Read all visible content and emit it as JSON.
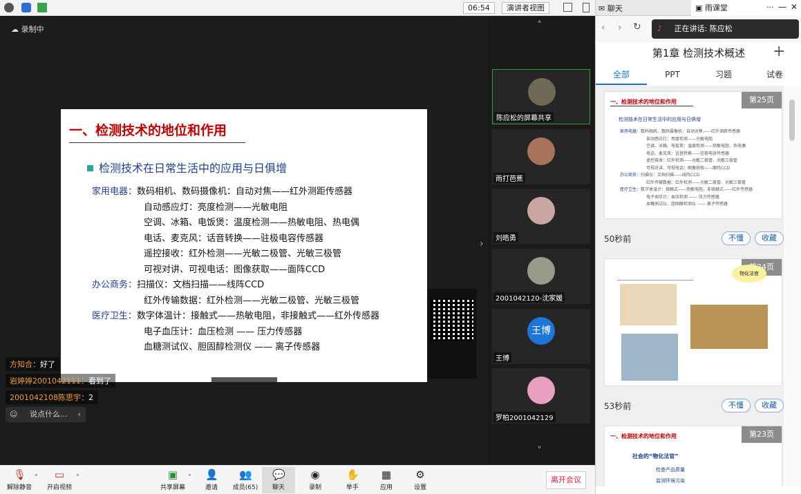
{
  "top": {
    "time": "06:54",
    "view_label": "演讲者视图"
  },
  "recording": "录制中",
  "slide": {
    "title": "一、检测技术的地位和作用",
    "subtitle": "检测技术在日常生活中的应用与日俱增",
    "lines": [
      {
        "cat": "家用电器：",
        "text": "数码相机、数码摄像机：自动对焦——红外测距传感器"
      },
      {
        "cat": "",
        "text": "自动感应灯：亮度检测——光敏电阻"
      },
      {
        "cat": "",
        "text": "空调、冰箱、电饭煲：温度检测——热敏电阻、热电偶"
      },
      {
        "cat": "",
        "text": "电话、麦克风：话音转换——驻极电容传感器"
      },
      {
        "cat": "",
        "text": "遥控接收：红外检测——光敏二极管、光敏三极管"
      },
      {
        "cat": "",
        "text": "可视对讲、可视电话：图像获取——面阵CCD"
      },
      {
        "cat": "办公商务：",
        "text": "扫描仪：文档扫描——线阵CCD"
      },
      {
        "cat": "",
        "text": "红外传输数据：红外检测——光敏二极管、光敏三极管"
      },
      {
        "cat": "医疗卫生：",
        "text": "数字体温计：接触式——热敏电阻，非接触式——红外传感器"
      },
      {
        "cat": "",
        "text": "电子血压计：血压检测 —— 压力传感器"
      },
      {
        "cat": "",
        "text": "血糖测试仪、胆固醇检测仪 —— 离子传感器"
      }
    ]
  },
  "chat": [
    {
      "name": "方知合：",
      "text": "好了"
    },
    {
      "name": "岩婷婷2001042111：",
      "text": "看到了"
    },
    {
      "name": "2001042108陈思宇：",
      "text": "2"
    }
  ],
  "say_placeholder": "说点什么...",
  "participants": [
    {
      "label": "陈应松的屏幕共享"
    },
    {
      "label": "雨打芭蕉"
    },
    {
      "label": "刘皓勇"
    },
    {
      "label": "2001042120-沈家媛"
    },
    {
      "label": "王博",
      "initials": "王博"
    },
    {
      "label": "罗柏2001042129"
    }
  ],
  "right": {
    "tab_chat": "聊天",
    "tab_rain": "雨课堂",
    "speaking": "正在讲话: 陈应松",
    "title": "第1章 检测技术概述",
    "tabs": [
      "全部",
      "PPT",
      "习题",
      "试卷"
    ],
    "cards": [
      {
        "page": "第25页",
        "time": "50秒前",
        "btn1": "不懂",
        "btn2": "收藏",
        "mini_title": "一、检测技术的地位和作用",
        "mini_sub": "检测技术在日常生活中的应用与日俱增"
      },
      {
        "page": "第24页",
        "time": "53秒前",
        "btn1": "不懂",
        "btn2": "收藏",
        "bubble": "物化法官"
      },
      {
        "page": "第23页",
        "mini_title": "一、检测技术的地位和作用",
        "mini_sub": "社会的“物化法官”",
        "b1": "检查产品质量",
        "b2": "监测环境污染"
      }
    ]
  },
  "toolbar": {
    "mute": "解除静音",
    "video": "开启视频",
    "share": "共享屏幕",
    "invite": "邀请",
    "members": "成员(65)",
    "chat": "聊天",
    "record": "录制",
    "hand": "举手",
    "apps": "应用",
    "settings": "设置",
    "leave": "离开会议"
  },
  "colors": {
    "accent": "#1a73c8",
    "slide_title": "#c00000",
    "leave": "#dd2233"
  }
}
